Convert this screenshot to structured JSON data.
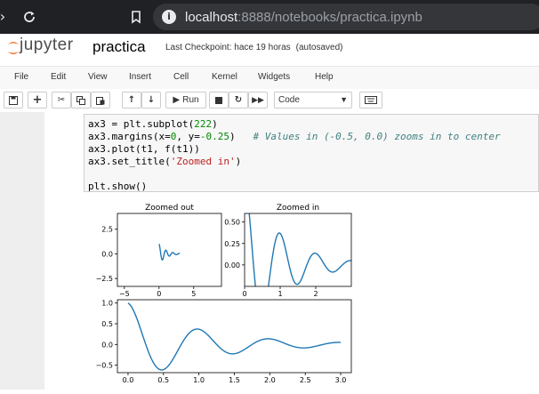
{
  "browser": {
    "url_host": "localhost",
    "url_rest": ":8888/notebooks/practica.ipynb"
  },
  "header": {
    "logo_text": "jupyter",
    "notebook_name": "practica",
    "checkpoint": "Last Checkpoint: hace 19 horas",
    "autosave": "(autosaved)"
  },
  "menu": [
    "File",
    "Edit",
    "View",
    "Insert",
    "Cell",
    "Kernel",
    "Widgets",
    "Help"
  ],
  "toolbar": {
    "run_label": "Run",
    "cell_type": "Code",
    "icons": [
      "save-icon",
      "plus-icon",
      "cut-icon",
      "copy-icon",
      "paste-icon",
      "arrow-up-icon",
      "arrow-down-icon",
      "play-icon",
      "stop-icon",
      "restart-icon",
      "fast-forward-icon",
      "keyboard-icon"
    ]
  },
  "code": {
    "line1": "ax3 = plt.subplot(",
    "line1_num": "222",
    "line1_end": ")",
    "line2a": "ax3.margins(x=",
    "line2_n1": "0",
    "line2b": ", y=",
    "line2_n2": "-0.25",
    "line2c": ")   ",
    "line2_comment": "# Values in (-0.5, 0.0) zooms in to center",
    "line3": "ax3.plot(t1, f(t1))",
    "line4a": "ax3.set_title(",
    "line4_str": "'Zoomed in'",
    "line4b": ")",
    "line6": "plt.show()"
  },
  "chart_data": [
    {
      "type": "line",
      "title": "Zoomed out",
      "xlim": [
        -6,
        9
      ],
      "ylim": [
        -3.3,
        4.1
      ],
      "xticks": [
        "−5",
        "0",
        "5"
      ],
      "yticks": [
        "2.5",
        "0.0",
        "−2.5"
      ],
      "function": "exp(-t)*cos(2*pi*t)",
      "x_range": [
        0,
        3
      ]
    },
    {
      "type": "line",
      "title": "Zoomed in",
      "xlim": [
        0,
        3
      ],
      "ylim": [
        -0.25,
        0.6
      ],
      "xticks": [
        "0",
        "1",
        "2"
      ],
      "yticks": [
        "0.50",
        "0.25",
        "0.00"
      ],
      "function": "exp(-t)*cos(2*pi*t)",
      "x_range": [
        0,
        3
      ]
    },
    {
      "type": "line",
      "title": "",
      "xlim": [
        -0.15,
        3.15
      ],
      "ylim": [
        -0.68,
        1.08
      ],
      "xticks": [
        "0.0",
        "0.5",
        "1.0",
        "1.5",
        "2.0",
        "2.5",
        "3.0"
      ],
      "yticks": [
        "1.0",
        "0.5",
        "0.0",
        "−0.5"
      ],
      "function": "exp(-t)*cos(2*pi*t)",
      "x_range": [
        0,
        3
      ]
    }
  ],
  "colors": {
    "line": "#1f77b4",
    "orange": "#f37626"
  }
}
